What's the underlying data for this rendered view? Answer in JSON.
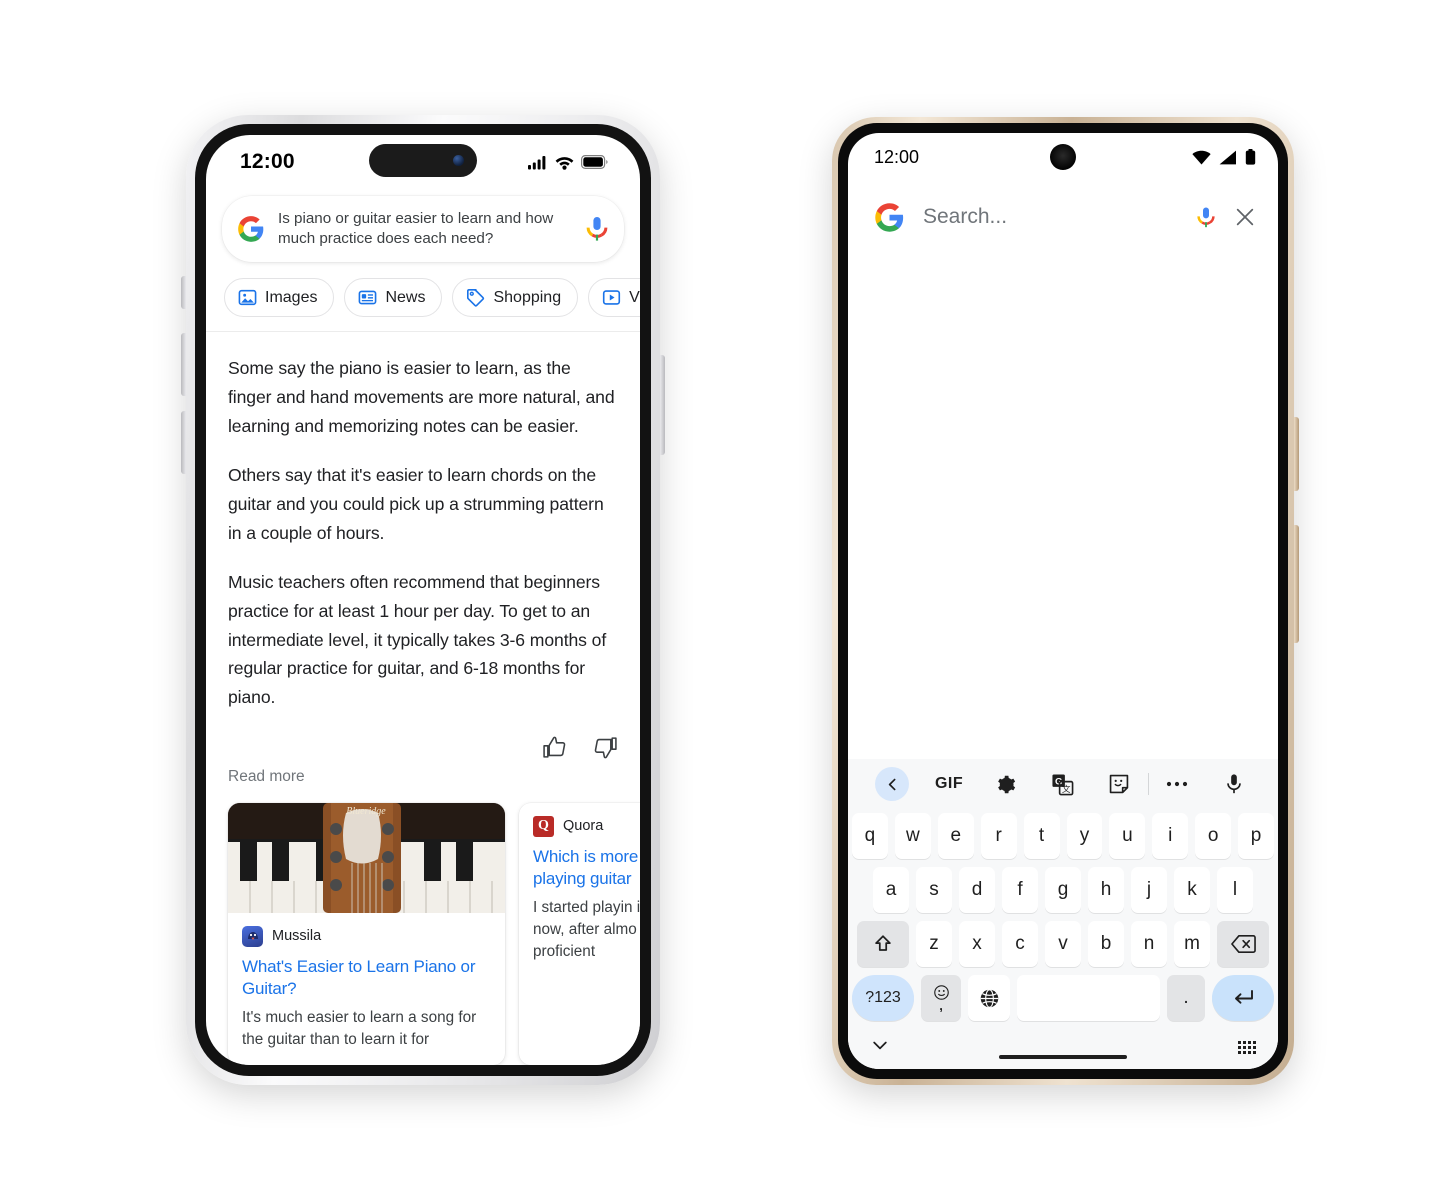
{
  "iphone": {
    "status": {
      "time": "12:00",
      "signal_icon": "cellular-signal-icon",
      "wifi_icon": "wifi-icon",
      "battery_icon": "battery-icon"
    },
    "search": {
      "logo": "google-logo",
      "query": "Is piano or guitar easier to learn and how much practice does each need?",
      "mic_icon": "microphone-icon"
    },
    "chips": [
      {
        "label": "Images",
        "icon": "image-icon"
      },
      {
        "label": "News",
        "icon": "news-article-icon"
      },
      {
        "label": "Shopping",
        "icon": "price-tag-icon"
      },
      {
        "label": "Videos",
        "icon": "play-video-icon"
      }
    ],
    "answer": {
      "paragraphs": [
        "Some say the piano is easier to learn, as the finger and hand movements are more natural, and learning and memorizing notes can be easier.",
        "Others say that it's easier to learn chords on the guitar and you could pick up a strumming pattern in a couple of hours.",
        "Music teachers often recommend that beginners practice for at least 1 hour per day. To get to an intermediate level, it typically takes 3-6 months of regular practice for guitar, and 6-18 months for piano."
      ],
      "thumbs_up_icon": "thumbs-up-icon",
      "thumbs_down_icon": "thumbs-down-icon",
      "read_more": "Read more"
    },
    "cards": [
      {
        "source": "Mussila",
        "favicon": "mussila-favicon",
        "title": "What's Easier to Learn Piano or Guitar?",
        "snippet": "It's much easier to learn a song for the guitar than to learn it for"
      },
      {
        "source": "Quora",
        "favicon": "quora-favicon",
        "favicon_letter": "Q",
        "title": "Which is more playing piano playing guitar",
        "snippet": "I started playin instruments th now, after almo continue to de proficient"
      }
    ]
  },
  "android": {
    "status": {
      "time": "12:00",
      "wifi_icon": "wifi-icon",
      "signal_icon": "cellular-signal-icon",
      "battery_icon": "battery-icon"
    },
    "search": {
      "logo": "google-logo",
      "placeholder": "Search...",
      "value": "",
      "mic_icon": "microphone-icon",
      "close_icon": "close-icon"
    },
    "keyboard": {
      "toolbar": [
        {
          "name": "back-chevron-icon",
          "label": ""
        },
        {
          "name": "gif-button",
          "label": "GIF"
        },
        {
          "name": "gear-icon",
          "label": ""
        },
        {
          "name": "translate-icon",
          "label": ""
        },
        {
          "name": "sticker-icon",
          "label": ""
        },
        {
          "name": "more-options-icon",
          "label": ""
        },
        {
          "name": "microphone-icon",
          "label": ""
        }
      ],
      "row1": [
        "q",
        "w",
        "e",
        "r",
        "t",
        "y",
        "u",
        "i",
        "o",
        "p"
      ],
      "row2": [
        "a",
        "s",
        "d",
        "f",
        "g",
        "h",
        "j",
        "k",
        "l"
      ],
      "row3": [
        "z",
        "x",
        "c",
        "v",
        "b",
        "n",
        "m"
      ],
      "shift_icon": "shift-key-icon",
      "backspace_icon": "backspace-key-icon",
      "numeric_label": "?123",
      "emoji_icon": "emoji-key-icon",
      "comma_label": ",",
      "globe_icon": "language-globe-icon",
      "space_label": "",
      "period_label": ".",
      "enter_icon": "enter-key-icon",
      "hide_icon": "chevron-down-icon",
      "switch_icon": "keyboard-switch-icon"
    }
  }
}
